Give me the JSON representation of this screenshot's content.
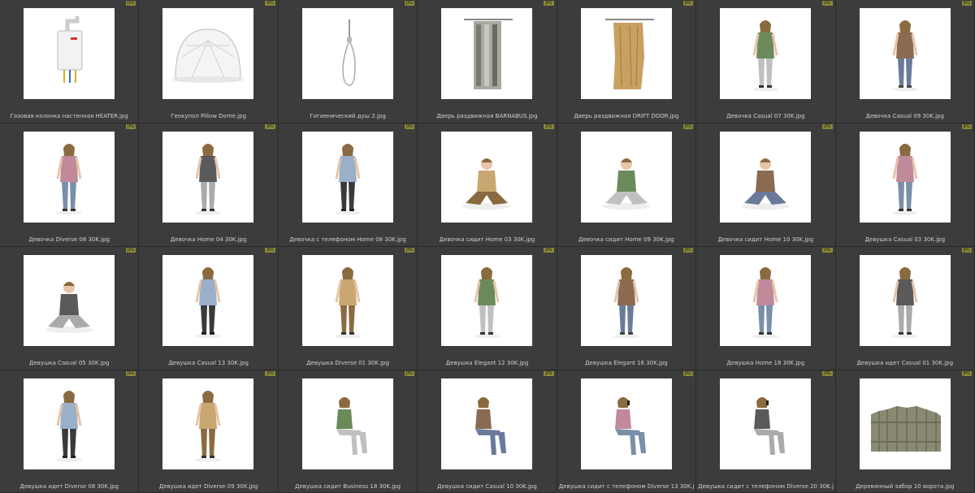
{
  "badge_label": "JPG",
  "colors": {
    "background": "#2a2a2a",
    "cell": "#3c3c3c",
    "badge": "#8a8a3a",
    "caption": "#cfcfcf"
  },
  "items": [
    {
      "name": "Газовая колонка настенная HEATER.jpg",
      "icon": "water-heater-icon",
      "kind": "object"
    },
    {
      "name": "Геокупол Pillow Dome.jpg",
      "icon": "dome-icon",
      "kind": "object"
    },
    {
      "name": "Гигиенический душ 2.jpg",
      "icon": "shower-icon",
      "kind": "object"
    },
    {
      "name": "Дверь раздвижная BARNABUS.jpg",
      "icon": "sliding-door-icon",
      "kind": "object"
    },
    {
      "name": "Дверь раздвижная DRIFT DOOR.jpg",
      "icon": "wooden-door-icon",
      "kind": "object"
    },
    {
      "name": "Девочка Casual 07 30K.jpg",
      "icon": "girl-figure-icon",
      "kind": "person"
    },
    {
      "name": "Девочка Casual 09 30K.jpg",
      "icon": "girl-figure-icon",
      "kind": "person"
    },
    {
      "name": "Девочка Diverse 08 30K.jpg",
      "icon": "girl-figure-icon",
      "kind": "person"
    },
    {
      "name": "Девочка Home 04 30K.jpg",
      "icon": "girl-with-bear-icon",
      "kind": "person"
    },
    {
      "name": "Девочка с телефоном Home 08 30K.jpg",
      "icon": "girl-phone-icon",
      "kind": "person"
    },
    {
      "name": "Девочка сидит Home 03 30K.jpg",
      "icon": "girl-sitting-icon",
      "kind": "sitting"
    },
    {
      "name": "Девочка сидит Home 09 30K.jpg",
      "icon": "girl-sitting-icon",
      "kind": "sitting"
    },
    {
      "name": "Девочка сидит Home 10 30K.jpg",
      "icon": "girl-kneeling-icon",
      "kind": "sitting"
    },
    {
      "name": "Девушка Casual 03 30K.jpg",
      "icon": "woman-figure-icon",
      "kind": "person"
    },
    {
      "name": "Девушка Casual 05 30K.jpg",
      "icon": "woman-crouching-icon",
      "kind": "sitting"
    },
    {
      "name": "Девушка Casual 13 30K.jpg",
      "icon": "woman-figure-icon",
      "kind": "person"
    },
    {
      "name": "Девушка Diverse 01 30K.jpg",
      "icon": "woman-dress-icon",
      "kind": "person"
    },
    {
      "name": "Девушка Elegant 12 30K.jpg",
      "icon": "woman-suit-icon",
      "kind": "person"
    },
    {
      "name": "Девушка Elegant 16 30K.jpg",
      "icon": "woman-dress-icon",
      "kind": "person"
    },
    {
      "name": "Девушка Home 18 30K.jpg",
      "icon": "woman-figure-icon",
      "kind": "person"
    },
    {
      "name": "Девушка идет Casual 01 30K.jpg",
      "icon": "woman-walking-icon",
      "kind": "person"
    },
    {
      "name": "Девушка идет Diverse 08 30K.jpg",
      "icon": "woman-dress-icon",
      "kind": "person"
    },
    {
      "name": "Девушка идет Diverse 09 30K.jpg",
      "icon": "woman-walking-icon",
      "kind": "person"
    },
    {
      "name": "Девушка сидит Business 18 30K.jpg",
      "icon": "woman-seated-icon",
      "kind": "seated"
    },
    {
      "name": "Девушка сидит Casual 10 30K.jpg",
      "icon": "woman-seated-icon",
      "kind": "seated"
    },
    {
      "name": "Девушка сидит с телефоном Diverse 13 30K.jpg",
      "icon": "woman-seated-phone-icon",
      "kind": "seated"
    },
    {
      "name": "Девушка сидит с телефоном Diverse 20 30K.jpg",
      "icon": "woman-seated-phone-icon",
      "kind": "seated"
    },
    {
      "name": "Деревянный забор 10 ворота.jpg",
      "icon": "wooden-fence-icon",
      "kind": "object"
    }
  ]
}
